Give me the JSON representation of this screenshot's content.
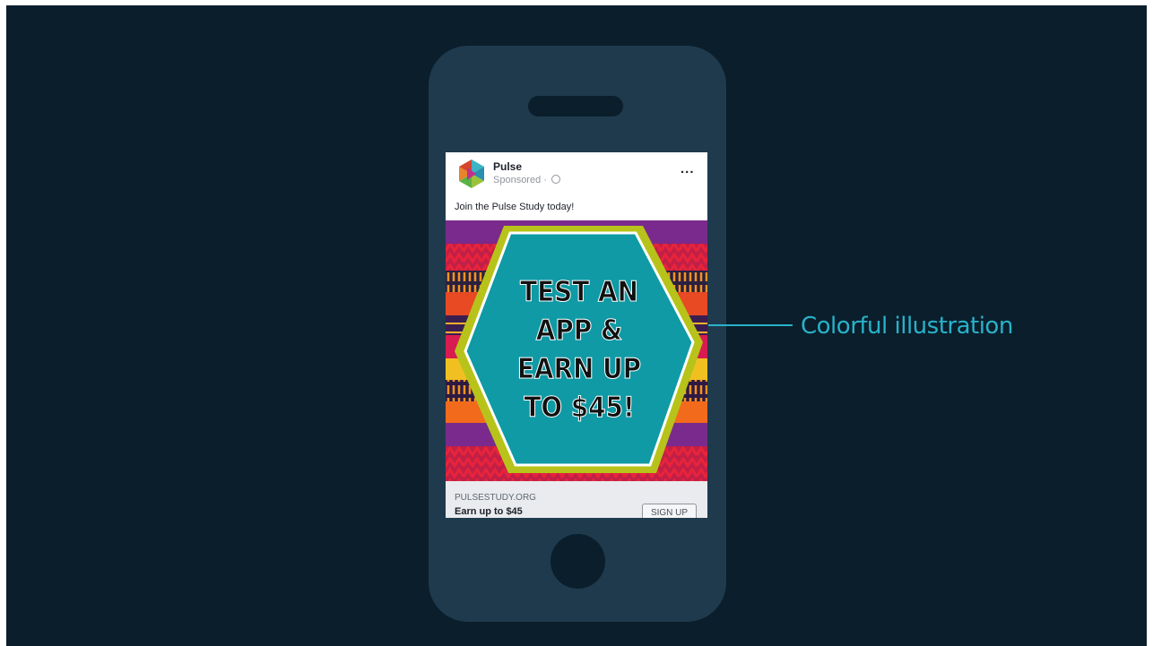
{
  "ad_post": {
    "page_name": "Pulse",
    "sponsored_label": "Sponsored ·",
    "more_icon_label": "...",
    "post_text": "Join the Pulse Study today!",
    "image_headline": [
      "TEST AN",
      "APP &",
      "EARN UP",
      "TO $45!"
    ],
    "link_domain": "PULSESTUDY.ORG",
    "link_title": "Earn up to $45",
    "cta_label": "SIGN UP"
  },
  "callout": {
    "label": "Colorful illustration"
  },
  "colors": {
    "slide_background": "#0a1e2c",
    "phone_body": "#1f3a4d",
    "callout_accent": "#29b2c9",
    "hexagon_fill": "#0f9aa5",
    "hexagon_border": "#b7c31a"
  }
}
